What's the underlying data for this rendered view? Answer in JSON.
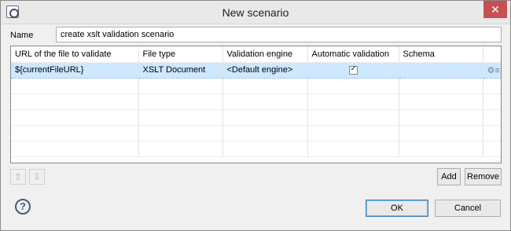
{
  "window": {
    "title": "New scenario",
    "close_glyph": "✕"
  },
  "name_row": {
    "label": "Name",
    "value": "create xslt validation scenario"
  },
  "table": {
    "columns": [
      "URL of the file to validate",
      "File type",
      "Validation engine",
      "Automatic validation",
      "Schema"
    ],
    "rows": [
      {
        "url": "${currentFileURL}",
        "file_type": "XSLT Document",
        "engine": "<Default engine>",
        "automatic": true,
        "schema": ""
      }
    ]
  },
  "buttons": {
    "up": "⇧",
    "down": "⇩",
    "add": "Add",
    "remove": "Remove",
    "ok": "OK",
    "cancel": "Cancel",
    "help": "?"
  },
  "icons": {
    "app": "app-icon",
    "row_action": "gear-icon"
  }
}
